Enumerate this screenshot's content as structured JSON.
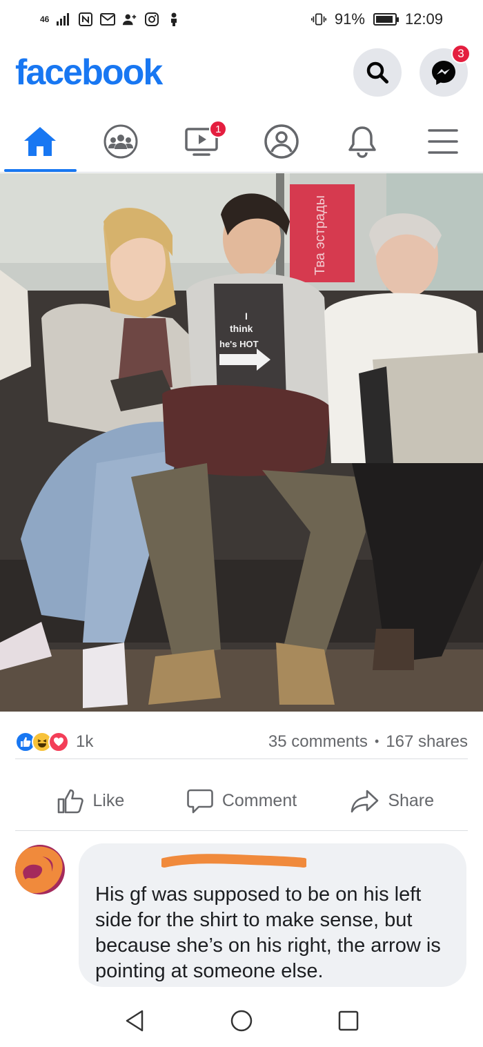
{
  "status_bar": {
    "network": "46",
    "battery_percent": "91%",
    "battery_level": 0.91,
    "time": "12:09",
    "icons": [
      "signal-icon",
      "nfc-icon",
      "mail-icon",
      "add-contact-icon",
      "instagram-icon",
      "person-icon",
      "vibrate-icon",
      "battery-icon"
    ]
  },
  "header": {
    "logo": "facebook",
    "messenger_badge": "3"
  },
  "nav": {
    "tabs": [
      {
        "name": "home",
        "icon": "home-icon",
        "active": true
      },
      {
        "name": "groups",
        "icon": "groups-icon"
      },
      {
        "name": "watch",
        "icon": "watch-icon",
        "badge": "1"
      },
      {
        "name": "profile",
        "icon": "profile-icon"
      },
      {
        "name": "notifications",
        "icon": "bell-icon"
      },
      {
        "name": "menu",
        "icon": "menu-icon"
      }
    ]
  },
  "post": {
    "photo": {
      "shirt_text_1": "I",
      "shirt_text_2": "think",
      "shirt_text_3": "he's HOT",
      "sign_text": "Тва эстрады"
    },
    "reactions": {
      "icons": [
        "like-icon",
        "haha-icon",
        "love-icon"
      ],
      "count": "1k",
      "comments": "35 comments",
      "separator": "•",
      "shares": "167 shares"
    },
    "actions": {
      "like": "Like",
      "comment": "Comment",
      "share": "Share"
    }
  },
  "comment": {
    "text": "His gf was supposed to be on his left side for the shirt to make sense, but because she’s on his right, the arrow is pointing at someone else."
  },
  "colors": {
    "brand": "#1877f2",
    "badge": "#e41e3f",
    "scribble": "#f08a3c"
  }
}
